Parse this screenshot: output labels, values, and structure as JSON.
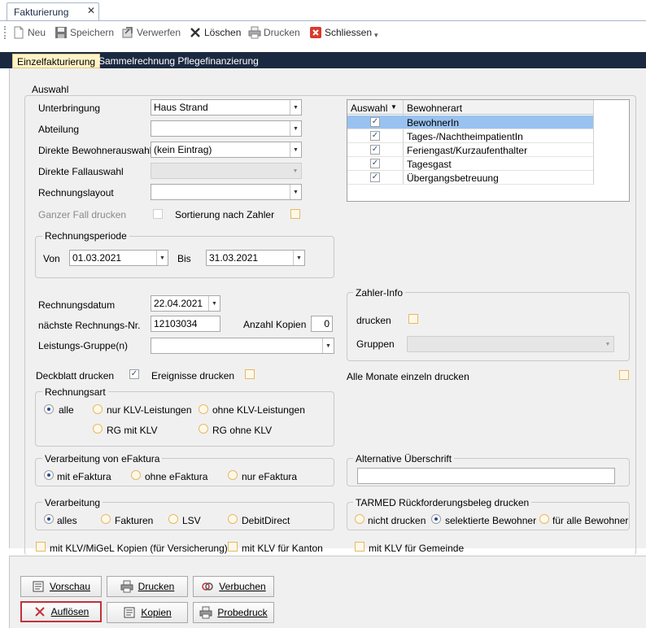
{
  "doc_tab": {
    "title": "Fakturierung",
    "close": "✕"
  },
  "toolbar": {
    "neu": "Neu",
    "speichern": "Speichern",
    "verwerfen": "Verwerfen",
    "loeschen": "Löschen",
    "drucken": "Drucken",
    "schliessen": "Schliessen"
  },
  "tabs": {
    "einzel": "Einzelfakturierung",
    "sammel": "Sammelrechnung Pflegefinanzierung"
  },
  "auswahl": {
    "title": "Auswahl",
    "unterbringung_label": "Unterbringung",
    "unterbringung_value": "Haus Strand",
    "abteilung_label": "Abteilung",
    "abteilung_value": "",
    "direkte_bewohner_label": "Direkte Bewohnerauswahl",
    "direkte_bewohner_value": "(kein Eintrag)",
    "direkte_fall_label": "Direkte Fallauswahl",
    "rechnungslayout_label": "Rechnungslayout",
    "ganzer_fall_label": "Ganzer Fall drucken",
    "sortierung_label": "Sortierung nach Zahler"
  },
  "grid": {
    "col_auswahl": "Auswahl",
    "col_bewohnerart": "Bewohnerart",
    "rows": [
      {
        "label": "BewohnerIn",
        "checked": "✓"
      },
      {
        "label": "Tages-/NachtheimpatientIn",
        "checked": "✓"
      },
      {
        "label": "Feriengast/Kurzaufenthalter",
        "checked": "✓"
      },
      {
        "label": "Tagesgast",
        "checked": "✓"
      },
      {
        "label": "Übergangsbetreuung",
        "checked": "✓"
      }
    ]
  },
  "periode": {
    "title": "Rechnungsperiode",
    "von_label": "Von",
    "von_value": "01.03.2021",
    "bis_label": "Bis",
    "bis_value": "31.03.2021"
  },
  "rechnung": {
    "datum_label": "Rechnungsdatum",
    "datum_value": "22.04.2021",
    "nr_label": "nächste Rechnungs-Nr.",
    "nr_value": "12103034",
    "kopien_label": "Anzahl Kopien",
    "kopien_value": "0",
    "leistungs_label": "Leistungs-Gruppe(n)"
  },
  "zahler": {
    "title": "Zahler-Info",
    "drucken_label": "drucken",
    "gruppen_label": "Gruppen"
  },
  "deckblatt": {
    "label": "Deckblatt drucken",
    "check": "✓"
  },
  "ereignisse": {
    "label": "Ereignisse drucken"
  },
  "alle_monate": {
    "label": "Alle Monate einzeln drucken"
  },
  "rechnungsart": {
    "title": "Rechnungsart",
    "alle": "alle",
    "nur_klv": "nur KLV-Leistungen",
    "ohne_klv": "ohne KLV-Leistungen",
    "rg_mit": "RG mit KLV",
    "rg_ohne": "RG ohne KLV"
  },
  "efaktura": {
    "title": "Verarbeitung von eFaktura",
    "mit": "mit eFaktura",
    "ohne": "ohne eFaktura",
    "nur": "nur eFaktura"
  },
  "alt_ueberschrift": {
    "title": "Alternative Überschrift",
    "value": ""
  },
  "verarbeitung": {
    "title": "Verarbeitung",
    "alles": "alles",
    "fakturen": "Fakturen",
    "lsv": "LSV",
    "debit": "DebitDirect"
  },
  "tarmed": {
    "title": "TARMED Rückforderungsbeleg drucken",
    "nicht": "nicht drucken",
    "selektiert": "selektierte Bewohner",
    "alle": "für alle Bewohner"
  },
  "klv": {
    "versicherung": "mit KLV/MiGeL Kopien (für Versicherung)",
    "kanton": "mit KLV für Kanton",
    "gemeinde": "mit KLV für Gemeinde"
  },
  "buttons": {
    "vorschau": "Vorschau",
    "drucken": "Drucken",
    "verbuchen": "Verbuchen",
    "aufloesen": "Auflösen",
    "kopien": "Kopien",
    "probedruck": "Probedruck"
  },
  "colors": {
    "navy": "#1b2940",
    "selected_row": "#99c2f0",
    "active_tab": "#fff3c8",
    "highlight_border": "#c0323a",
    "checkbox_orange": "#e6b865"
  }
}
